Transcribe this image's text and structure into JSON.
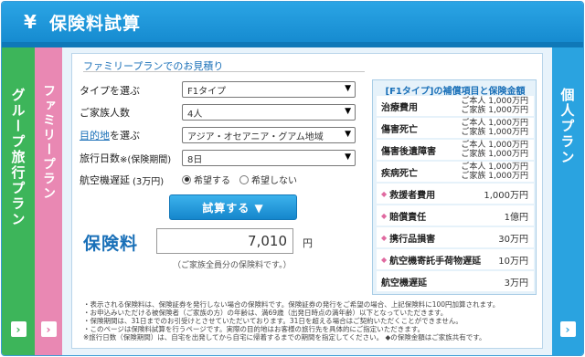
{
  "header": {
    "yen_symbol": "¥",
    "title": "保険料試算"
  },
  "tabs": {
    "group": "グループ旅行プラン",
    "family": "ファミリープラン",
    "personal": "個人プラン",
    "arrow": "›"
  },
  "form": {
    "section_title": "ファミリープランでのお見積り",
    "type_label": "タイプを選ぶ",
    "type_value": "F1タイプ",
    "family_label": "ご家族人数",
    "family_value": "4人",
    "destination_label_link": "目的地",
    "destination_label_rest": "を選ぶ",
    "destination_value": "アジア・オセアニア・グアム地域",
    "days_label": "旅行日数",
    "days_label_small": "※(保険期間)",
    "days_value": "8日",
    "delay_label": "航空機遅延",
    "delay_label_small": "(3万円)",
    "delay_yes": "希望する",
    "delay_no": "希望しない",
    "calc_button": "試算する ▼"
  },
  "premium": {
    "label": "保険料",
    "value": "7,010",
    "unit": "円",
    "note": "（ご家族全員分の保険料です。）"
  },
  "coverage": {
    "title": "[F1タイプ]の補償項目と保険金額",
    "rows": [
      {
        "name": "治療費用",
        "line1": "ご本人 1,000万円",
        "line2": "ご家族 1,000万円"
      },
      {
        "name": "傷害死亡",
        "line1": "ご本人 1,000万円",
        "line2": "ご家族 1,000万円"
      },
      {
        "name": "傷害後遺障害",
        "line1": "ご本人 1,000万円",
        "line2": "ご家族 1,000万円"
      },
      {
        "name": "疾病死亡",
        "line1": "ご本人 1,000万円",
        "line2": "ご家族 1,000万円"
      },
      {
        "name": "救援者費用",
        "value": "1,000万円",
        "diamond": "◆"
      },
      {
        "name": "賠償責任",
        "value": "1億円",
        "diamond": "◆"
      },
      {
        "name": "携行品損害",
        "value": "30万円",
        "diamond": "◆"
      },
      {
        "name": "航空機寄託手荷物遅延",
        "value": "10万円",
        "diamond": "◆"
      },
      {
        "name": "航空機遅延",
        "value": "3万円"
      }
    ]
  },
  "notes": [
    "・表示される保険料は、保険証券を発行しない場合の保険料です。保険証券の発行をご希望の場合、上記保険料に100円加算されます。",
    "・お申込みいただける被保険者（ご家族の方）の年齢は、満69歳（出発日時点の満年齢）以下となっていただきます。",
    "・保険期間は、31日までのお引受けとさせていただいております。31日を超える場合はご契約いただくことができません。",
    "・このページは保険料試算を行うページです。実際の目的地はお客様の旅行先を具体的にご指定いただきます。",
    "※旅行日数（保険期間）は、自宅を出発してから自宅に帰着するまでの期間を指定してください。 ◆の保険金額はご家族共有です。"
  ]
}
